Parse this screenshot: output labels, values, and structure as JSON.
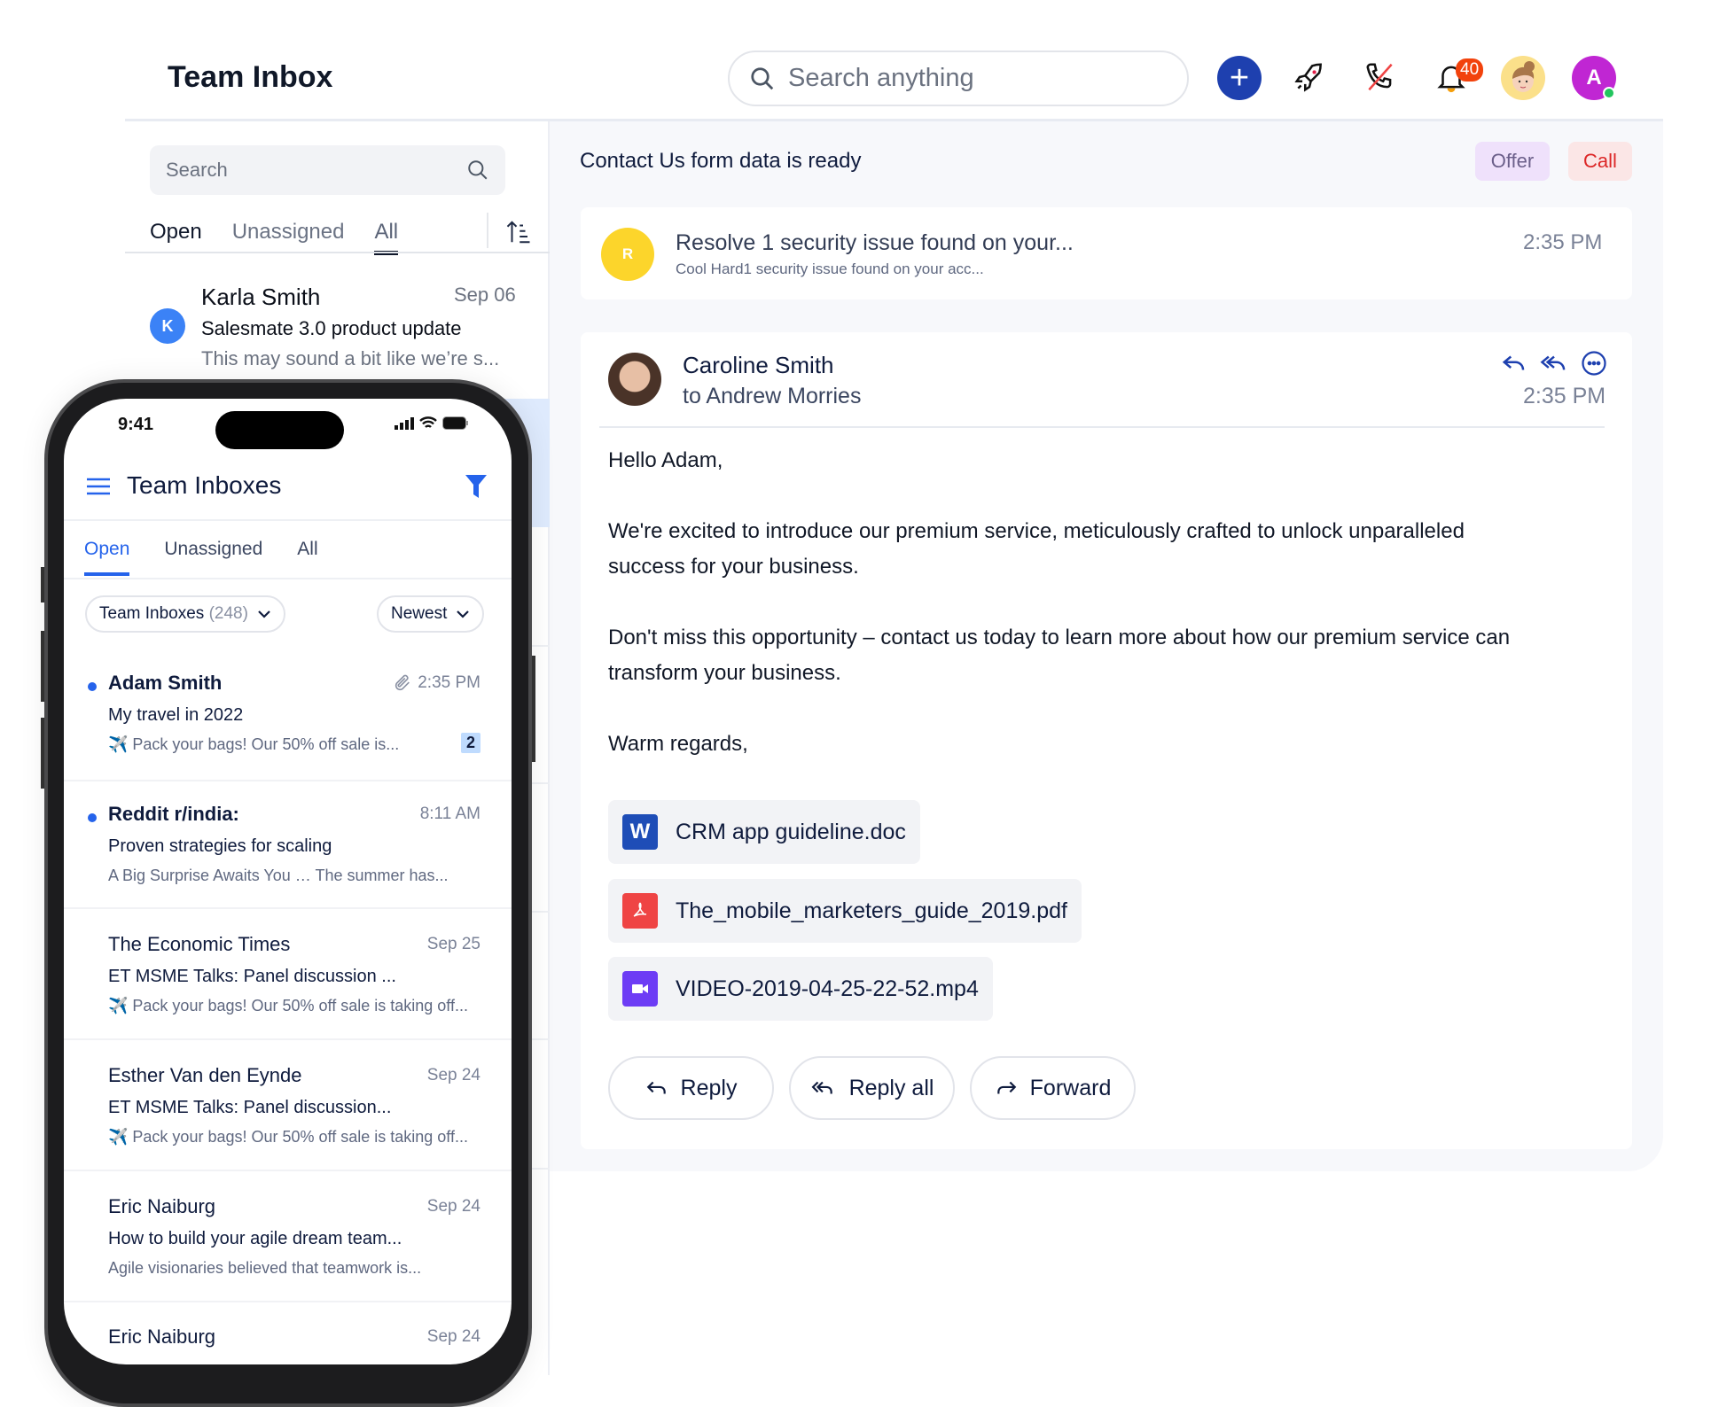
{
  "header": {
    "title": "Team Inbox",
    "search_placeholder": "Search anything",
    "notification_count": "40",
    "user_initial": "A"
  },
  "left": {
    "search_placeholder": "Search",
    "tabs": [
      "Open",
      "Unassigned",
      "All"
    ],
    "selected_tab": "All",
    "conversations": [
      {
        "initial": "K",
        "name": "Karla Smith",
        "date": "Sep 06",
        "subject": "Salesmate 3.0 product update",
        "preview": "This may sound a bit like we’re s..."
      }
    ]
  },
  "detail": {
    "title": "Contact Us form data is ready",
    "tags": [
      "Offer",
      "Call"
    ],
    "notice": {
      "initial": "R",
      "title": "Resolve 1 security issue found on your...",
      "subtitle": "Cool Hard1 security issue found on your acc...",
      "time": "2:35 PM"
    },
    "email": {
      "sender": "Caroline Smith",
      "to": "to Andrew Morries",
      "time": "2:35 PM",
      "body": [
        "Hello Adam,",
        "We're excited to introduce our premium service, meticulously crafted to unlock unparalleled success for your business.",
        "Don't miss this opportunity – contact us today to learn more about how our premium service can transform your business.",
        "Warm regards,"
      ],
      "attachments": [
        {
          "name": "CRM app guideline.doc",
          "type": "word",
          "icon_label": "W",
          "color": "#1e4db7"
        },
        {
          "name": "The_mobile_marketers_guide_2019.pdf",
          "type": "pdf",
          "color": "#ef4444"
        },
        {
          "name": "VIDEO-2019-04-25-22-52.mp4",
          "type": "video",
          "color": "#6d3cf5"
        }
      ],
      "actions": [
        "Reply",
        "Reply all",
        "Forward"
      ]
    }
  },
  "phone": {
    "time": "9:41",
    "title": "Team Inboxes",
    "tabs": [
      "Open",
      "Unassigned",
      "All"
    ],
    "selected_tab": "Open",
    "inbox_filter": "Team Inboxes",
    "inbox_count": "(248)",
    "sort": "Newest",
    "messages": [
      {
        "name": "Adam Smith",
        "time": "2:35 PM",
        "subject": "My travel in 2022",
        "preview": "✈️ Pack your bags! Our 50% off sale is...",
        "unread": true,
        "attachment": true,
        "count": "2"
      },
      {
        "name": "Reddit r/india:",
        "time": "8:11 AM",
        "subject": "Proven strategies for scaling",
        "preview": "A Big Surprise Awaits You … The summer has...",
        "unread": true
      },
      {
        "name": "The Economic Times",
        "time": "Sep 25",
        "subject": "ET MSME Talks: Panel discussion ...",
        "preview": "✈️ Pack your bags! Our 50% off sale is taking off..."
      },
      {
        "name": "Esther Van den Eynde",
        "time": "Sep 24",
        "subject": "ET MSME Talks: Panel discussion...",
        "preview": "✈️ Pack your bags! Our 50% off sale is taking off..."
      },
      {
        "name": "Eric Naiburg",
        "time": "Sep 24",
        "subject": "How to build your agile dream team...",
        "preview": "Agile visionaries believed that teamwork is..."
      },
      {
        "name": "Eric Naiburg",
        "time": "Sep 24",
        "subject": "",
        "preview": ""
      }
    ]
  },
  "colors": {
    "primary": "#1e40af",
    "accent_blue": "#2563eb",
    "badge": "#f2420c",
    "avatar_purple": "#c026d3"
  }
}
